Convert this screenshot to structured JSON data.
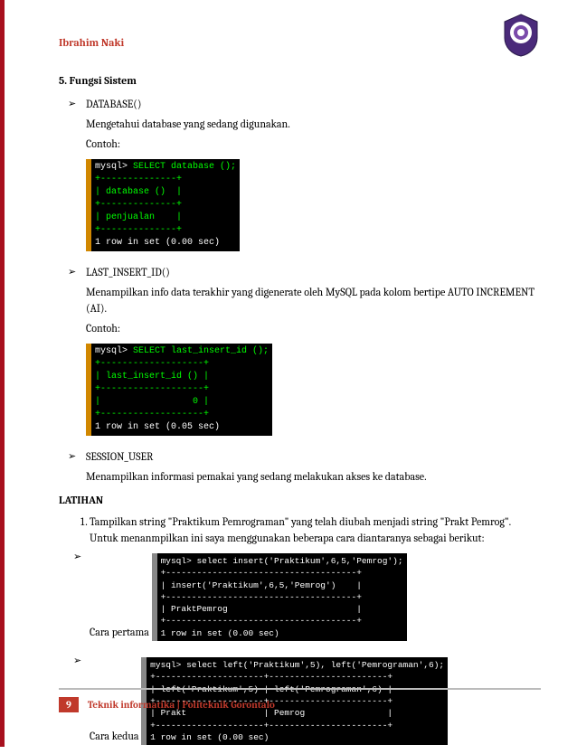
{
  "author": "Ibrahim Naki",
  "section": {
    "number": "5.",
    "title": "Fungsi Sistem"
  },
  "functions": [
    {
      "name": "DATABASE()",
      "desc": "Mengetahui database yang sedang digunakan.",
      "label": "Contoh:",
      "terminal": {
        "prompt": "mysql>",
        "query": " SELECT database ();",
        "lines": [
          "+--------------+",
          "| database ()  |",
          "+--------------+",
          "| penjualan    |",
          "+--------------+"
        ],
        "footer": "1 row in set (0.00 sec)"
      }
    },
    {
      "name": "LAST_INSERT_ID()",
      "desc": "Menampilkan info data terakhir yang digenerate oleh MySQL pada kolom bertipe AUTO INCREMENT (AI).",
      "label": "Contoh:",
      "terminal": {
        "prompt": "mysql>",
        "query": " SELECT last_insert_id ();",
        "lines": [
          "+-------------------+",
          "| last_insert_id () |",
          "+-------------------+",
          "|                 0 |",
          "+-------------------+"
        ],
        "footer": "1 row in set (0.05 sec)"
      }
    },
    {
      "name": "SESSION_USER",
      "desc": "Menampilkan informasi pemakai yang sedang melakukan akses ke database.",
      "label": "",
      "terminal": null
    }
  ],
  "latihan": {
    "title": "LATIHAN",
    "items": [
      {
        "text": "Tampilkan string \"Praktikum Pemrograman\" yang telah diubah menjadi string \"Prakt Pemrog\".",
        "note": "Untuk menanmpilkan ini saya menggunakan beberapa cara diantaranya sebagai berikut:",
        "methods": [
          {
            "label": "Cara pertama",
            "terminal": {
              "prompt": "mysql>",
              "query": " select insert('Praktikum',6,5,'Pemrog');",
              "lines": [
                "+-------------------------------------+",
                "| insert('Praktikum',6,5,'Pemrog')    |",
                "+-------------------------------------+",
                "| PraktPemrog                         |",
                "+-------------------------------------+"
              ],
              "footer": "1 row in set (0.00 sec)"
            }
          },
          {
            "label": "Cara kedua",
            "terminal": {
              "prompt": "mysql>",
              "query": " select left('Praktikum',5), left('Pemrograman',6);",
              "lines": [
                "+---------------------+-----------------------+",
                "| left('Praktikum',5) | left('Pemrograman',6) |",
                "+---------------------+-----------------------+",
                "| Prakt               | Pemrog                |",
                "+---------------------+-----------------------+"
              ],
              "footer": "1 row in set (0.00 sec)"
            }
          }
        ]
      }
    ]
  },
  "footer": {
    "page": "9",
    "text": "Teknik informatika | Politeknik Gorontalo"
  }
}
